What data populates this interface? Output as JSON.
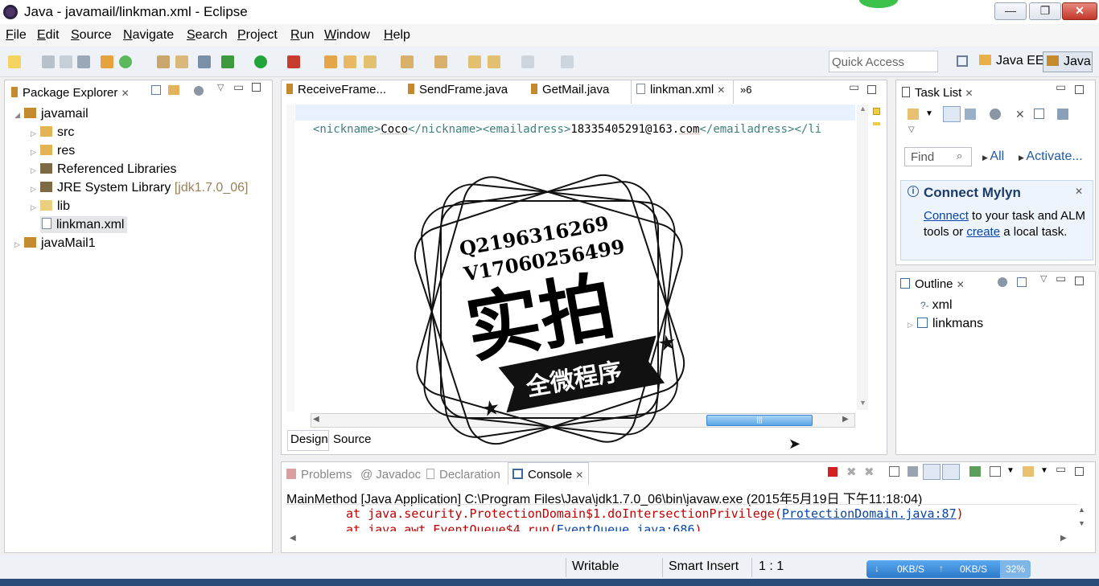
{
  "window": {
    "title": "Java - javamail/linkman.xml - Eclipse",
    "minimize": "—",
    "maximize": "❐",
    "close": "✕"
  },
  "menu": [
    "File",
    "Edit",
    "Source",
    "Navigate",
    "Search",
    "Project",
    "Run",
    "Window",
    "Help"
  ],
  "toolbar": {
    "quick_access": "Quick Access",
    "perspectives": [
      "Java EE",
      "Java"
    ]
  },
  "package_explorer": {
    "title": "Package Explorer",
    "tree": [
      {
        "label": "javamail",
        "level": 0,
        "expanded": true
      },
      {
        "label": "src",
        "level": 1
      },
      {
        "label": "res",
        "level": 1
      },
      {
        "label": "Referenced Libraries",
        "level": 1
      },
      {
        "label": "JRE System Library",
        "suffix": "[jdk1.7.0_06]",
        "level": 1
      },
      {
        "label": "lib",
        "level": 1
      },
      {
        "label": "linkman.xml",
        "level": 1,
        "selected": true
      },
      {
        "label": "javaMail1",
        "level": 0
      }
    ]
  },
  "editor": {
    "tabs": [
      "ReceiveFrame...",
      "SendFrame.java",
      "GetMail.java",
      "linkman.xml"
    ],
    "active_tab": "linkman.xml",
    "overflow": "»6",
    "code": {
      "t1": "<nickname>",
      "v1": "Coco",
      "t2": "</nickname>",
      "t3": "<emailadress>",
      "v2": "18335405291@163.",
      "v3": "com",
      "t4": "</emailadress>",
      "t5": "</li"
    },
    "bottom_tabs": [
      "Design",
      "Source"
    ]
  },
  "overlay_stamp": {
    "line1": "Q2196316269",
    "line2": "V17060256499",
    "big": "实拍",
    "banner": "全微程序"
  },
  "task_list": {
    "title": "Task List",
    "find_placeholder": "Find",
    "all": "All",
    "activate": "Activate..."
  },
  "mylyn": {
    "title": "Connect Mylyn",
    "link1": "Connect",
    "text1": " to your task and ALM tools or ",
    "link2": "create",
    "text2": " a local task."
  },
  "outline": {
    "title": "Outline",
    "items": [
      "xml",
      "linkmans"
    ]
  },
  "console": {
    "tabs": [
      "Problems",
      "Javadoc",
      "Declaration",
      "Console"
    ],
    "header": "MainMethod [Java Application] C:\\Program Files\\Java\\jdk1.7.0_06\\bin\\javaw.exe (2015年5月19日 下午11:18:04)",
    "line1_prefix": "at java.security.ProtectionDomain$1.doIntersectionPrivilege(",
    "line1_link": "ProtectionDomain.java:87",
    "line1_suffix": ")",
    "line2_prefix": "at java.awt.EventQueue$4.run(",
    "line2_link": "EventQueue.java:686",
    "line2_suffix": ")"
  },
  "status": {
    "writable": "Writable",
    "insert": "Smart Insert",
    "position": "1 : 1",
    "down": "0KB/S",
    "up": "0KB/S",
    "percent": "32%"
  },
  "colors": {
    "tag": "#3f7f7f",
    "text": "#000000",
    "link": "#0645ad",
    "console_error": "#c00000",
    "accent": "#3b86d6"
  }
}
